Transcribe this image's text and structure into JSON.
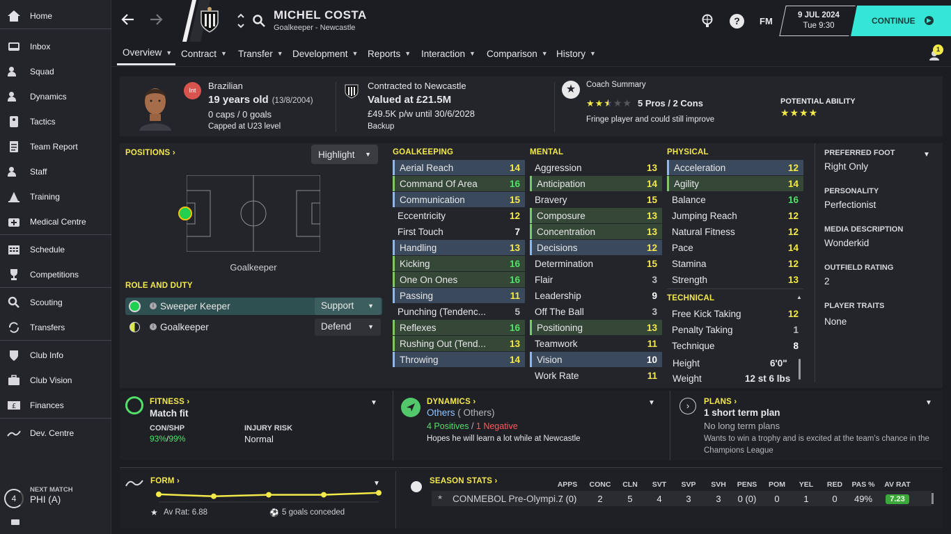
{
  "sidebar": {
    "items": [
      "Home",
      "Inbox",
      "Squad",
      "Dynamics",
      "Tactics",
      "Team Report",
      "Staff",
      "Training",
      "Medical Centre",
      "Schedule",
      "Competitions",
      "Scouting",
      "Transfers",
      "Club Info",
      "Club Vision",
      "Finances",
      "Dev. Centre"
    ],
    "next_match_label": "NEXT MATCH",
    "next_match_value": "PHI (A)",
    "next_match_days": "4"
  },
  "header": {
    "player_name": "MICHEL COSTA",
    "subtitle": "Goalkeeper - Newcastle",
    "date": "9 JUL 2024",
    "time": "Tue 9:30",
    "continue_label": "CONTINUE",
    "fm_label": "FM",
    "notif_count": "1"
  },
  "tabs": [
    "Overview",
    "Contract",
    "Transfer",
    "Development",
    "Reports",
    "Interaction",
    "Comparison",
    "History"
  ],
  "profile": {
    "nationality": "Brazilian",
    "nat_badge": "Int",
    "age": "19 years old",
    "dob": "(13/8/2004)",
    "caps": "0 caps / 0 goals",
    "capped": "Capped at U23 level",
    "contract": "Contracted to Newcastle",
    "value": "Valued at £21.5M",
    "wage": "£49.5K p/w until 30/6/2028",
    "squad_status": "Backup",
    "coach_summary_label": "Coach Summary",
    "pros_cons": "5 Pros / 2 Cons",
    "coach_note": "Fringe player and could still improve",
    "coach_stars": 2.5,
    "potential_label": "POTENTIAL ABILITY",
    "potential_stars": 4
  },
  "positions": {
    "label": "POSITIONS",
    "highlight": "Highlight",
    "position_name": "Goalkeeper",
    "role_label": "ROLE AND DUTY",
    "roles": [
      {
        "name": "Sweeper Keeper",
        "duty": "Support"
      },
      {
        "name": "Goalkeeper",
        "duty": "Defend"
      }
    ]
  },
  "goalkeeping": {
    "label": "GOALKEEPING",
    "attrs": [
      [
        "Aerial Reach",
        "14"
      ],
      [
        "Command Of Area",
        "16"
      ],
      [
        "Communication",
        "15"
      ],
      [
        "Eccentricity",
        "12"
      ],
      [
        "First Touch",
        "7"
      ],
      [
        "Handling",
        "13"
      ],
      [
        "Kicking",
        "16"
      ],
      [
        "One On Ones",
        "16"
      ],
      [
        "Passing",
        "11"
      ],
      [
        "Punching (Tendenc...",
        "5"
      ],
      [
        "Reflexes",
        "16"
      ],
      [
        "Rushing Out (Tend...",
        "13"
      ],
      [
        "Throwing",
        "14"
      ]
    ]
  },
  "mental": {
    "label": "MENTAL",
    "attrs": [
      [
        "Aggression",
        "13"
      ],
      [
        "Anticipation",
        "14"
      ],
      [
        "Bravery",
        "15"
      ],
      [
        "Composure",
        "13"
      ],
      [
        "Concentration",
        "13"
      ],
      [
        "Decisions",
        "12"
      ],
      [
        "Determination",
        "15"
      ],
      [
        "Flair",
        "3"
      ],
      [
        "Leadership",
        "9"
      ],
      [
        "Off The Ball",
        "3"
      ],
      [
        "Positioning",
        "13"
      ],
      [
        "Teamwork",
        "11"
      ],
      [
        "Vision",
        "10"
      ],
      [
        "Work Rate",
        "11"
      ]
    ]
  },
  "physical": {
    "label": "PHYSICAL",
    "attrs": [
      [
        "Acceleration",
        "12"
      ],
      [
        "Agility",
        "14"
      ],
      [
        "Balance",
        "16"
      ],
      [
        "Jumping Reach",
        "12"
      ],
      [
        "Natural Fitness",
        "12"
      ],
      [
        "Pace",
        "14"
      ],
      [
        "Stamina",
        "12"
      ],
      [
        "Strength",
        "13"
      ]
    ]
  },
  "technical": {
    "label": "TECHNICAL",
    "attrs": [
      [
        "Free Kick Taking",
        "12"
      ],
      [
        "Penalty Taking",
        "1"
      ],
      [
        "Technique",
        "8"
      ]
    ],
    "height_label": "Height",
    "height": "6'0\"",
    "weight_label": "Weight",
    "weight": "12 st 6 lbs"
  },
  "info": {
    "foot_label": "PREFERRED FOOT",
    "foot": "Right Only",
    "personality_label": "PERSONALITY",
    "personality": "Perfectionist",
    "media_label": "MEDIA DESCRIPTION",
    "media": "Wonderkid",
    "outfield_label": "OUTFIELD RATING",
    "outfield": "2",
    "traits_label": "PLAYER TRAITS",
    "traits": "None"
  },
  "fitness": {
    "label": "FITNESS",
    "status": "Match fit",
    "conshp_label": "CON/SHP",
    "con": "93%",
    "shp": "99%",
    "injury_label": "INJURY RISK",
    "injury": "Normal"
  },
  "dynamics": {
    "label": "DYNAMICS",
    "group": "Others",
    "group_paren": "( Others)",
    "positives": "4 Positives",
    "negatives": "1 Negative",
    "note": "Hopes he will learn a lot while at Newcastle"
  },
  "plans": {
    "label": "PLANS",
    "short": "1 short term plan",
    "long": "No long term plans",
    "note": "Wants to win a trophy and is excited at the team's chance in the Champions League"
  },
  "form": {
    "label": "FORM",
    "avg": "Av Rat: 6.88",
    "conceded": "5 goals conceded",
    "points": [
      0.35,
      0.55,
      0.4,
      0.4,
      0.2
    ]
  },
  "season": {
    "label": "SEASON STATS",
    "headers": [
      "APPS",
      "CONC",
      "CLN",
      "SVT",
      "SVP",
      "SVH",
      "PENS",
      "POM",
      "YEL",
      "RED",
      "PAS %",
      "AV RAT"
    ],
    "competition": "CONMEBOL Pre-Olympi...",
    "values": [
      "7 (0)",
      "2",
      "5",
      "4",
      "3",
      "3",
      "0 (0)",
      "0",
      "1",
      "0",
      "49%",
      "7.23"
    ]
  },
  "colors": {
    "accent_yellow": "#f4e94a",
    "green": "#52e06a",
    "continue_bg": "#2ee0d2",
    "negative": "#ff5a5a"
  }
}
